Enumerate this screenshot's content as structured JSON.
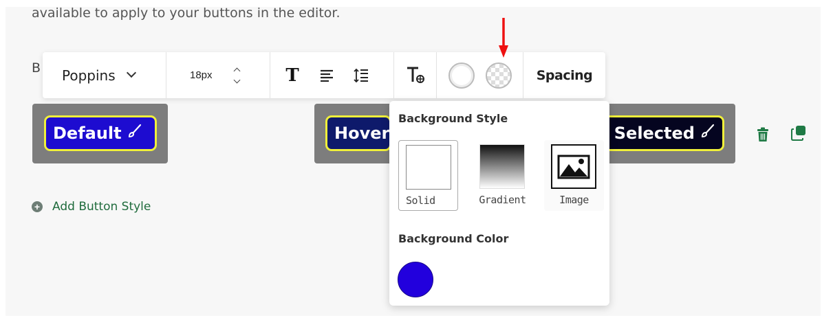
{
  "intro_text": "available to apply to your buttons in the editor.",
  "section_letter": "B",
  "toolbar": {
    "font_family": "Poppins",
    "font_size": "18px",
    "spacing_label": "Spacing"
  },
  "button_states": {
    "default_label": "Default",
    "hover_label": "Hover",
    "selected_label": "Selected"
  },
  "add_button_style_label": "Add Button Style",
  "dropdown": {
    "background_style_heading": "Background Style",
    "options": [
      {
        "label": "Solid",
        "selected": true
      },
      {
        "label": "Gradient",
        "selected": false
      },
      {
        "label": "Image",
        "selected": false
      }
    ],
    "background_color_heading": "Background Color",
    "background_color": "#2200dd"
  },
  "colors": {
    "button_default_bg": "#1d0cd0",
    "button_hover_bg": "#0e1a6b",
    "button_selected_bg": "#050520",
    "button_border": "#f0f03a",
    "card_bg": "#7d7d7d",
    "accent_green": "#1f6b3c",
    "annotation_arrow": "#ee1111"
  },
  "icons": [
    "chevron-down-icon",
    "stepper-icon",
    "text-bold-icon",
    "align-left-icon",
    "line-height-icon",
    "clear-format-icon",
    "solid-background-icon",
    "transparent-background-icon",
    "paintbrush-icon",
    "trash-icon",
    "duplicate-icon",
    "add-icon",
    "image-icon"
  ]
}
